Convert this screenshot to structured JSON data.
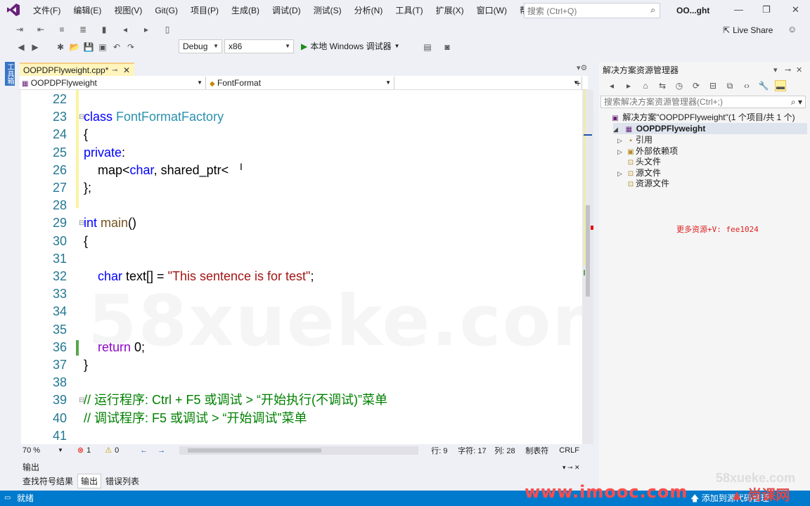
{
  "menu": {
    "items": [
      "文件(F)",
      "编辑(E)",
      "视图(V)",
      "Git(G)",
      "项目(P)",
      "生成(B)",
      "调试(D)",
      "测试(S)",
      "分析(N)",
      "工具(T)",
      "扩展(X)",
      "窗口(W)",
      "帮助(H)"
    ],
    "search_placeholder": "搜索 (Ctrl+Q)",
    "window_title_short": "OO...ght"
  },
  "toolbar": {
    "config": "Debug",
    "platform": "x86",
    "run_label": "本地 Windows 调试器",
    "live_share": "Live Share"
  },
  "left_strip_tab": "工具箱",
  "editor": {
    "tab_label": "OOPDPFlyweight.cpp*",
    "nav_scope": "OOPDPFlyweight",
    "nav_member": "FontFormat",
    "lines": [
      {
        "n": "22",
        "html": ""
      },
      {
        "n": "23",
        "html": "<span class=\"kw\">class</span> <span class=\"cls\">FontFormatFactory</span>"
      },
      {
        "n": "24",
        "html": "{"
      },
      {
        "n": "25",
        "html": "<span class=\"kw\">private</span>:"
      },
      {
        "n": "26",
        "html": "    map&lt;<span class=\"kw\">char</span>, shared_ptr&lt;"
      },
      {
        "n": "27",
        "html": "};"
      },
      {
        "n": "28",
        "html": ""
      },
      {
        "n": "29",
        "html": "<span class=\"kw\">int</span> <span class=\"fn\">main</span>()"
      },
      {
        "n": "30",
        "html": "{"
      },
      {
        "n": "31",
        "html": ""
      },
      {
        "n": "32",
        "html": "    <span class=\"kw\">char</span> text[] = <span class=\"str\">\"This sentence is for test\"</span>;"
      },
      {
        "n": "33",
        "html": ""
      },
      {
        "n": "34",
        "html": ""
      },
      {
        "n": "35",
        "html": ""
      },
      {
        "n": "36",
        "html": "    <span class=\"kw2\">return</span> 0;"
      },
      {
        "n": "37",
        "html": "}"
      },
      {
        "n": "38",
        "html": ""
      },
      {
        "n": "39",
        "html": "<span class=\"cmt\">// 运行程序: Ctrl + F5 或调试 &gt; “开始执行(不调试)”菜单</span>"
      },
      {
        "n": "40",
        "html": "<span class=\"cmt\">// 调试程序: F5 或调试 &gt; “开始调试”菜单</span>"
      },
      {
        "n": "41",
        "html": ""
      }
    ],
    "watermark": "58xueke.com"
  },
  "status_editor": {
    "zoom": "70 %",
    "errors": "1",
    "warnings": "0",
    "line": "行: 9",
    "char": "字符: 17",
    "col": "列: 28",
    "tabs": "制表符",
    "eol": "CRLF"
  },
  "output": {
    "title": "输出",
    "tabs": [
      "查找符号结果",
      "输出",
      "错误列表"
    ],
    "active_tab": 1
  },
  "statusbar": {
    "left": "就绪",
    "right": "添加到源代码管理"
  },
  "solution_explorer": {
    "title": "解决方案资源管理器",
    "search_placeholder": "搜索解决方案资源管理器(Ctrl+;)",
    "solution": "解决方案\"OOPDPFlyweight\"(1 个项目/共 1 个)",
    "project": "OOPDPFlyweight",
    "nodes": [
      "引用",
      "外部依赖项",
      "头文件",
      "源文件",
      "资源文件"
    ]
  },
  "overlays": {
    "more_resources": "更多资源+V: fee1024",
    "imooc": "www.imooc.com",
    "shangke": "▲ 尚课网",
    "corner_wm": "58xueke.com"
  },
  "colors": {
    "accent": "#007acc",
    "keyword": "#0000ff",
    "class": "#2b91af",
    "string": "#a31515",
    "comment": "#008000",
    "return_kw": "#8f08c4"
  }
}
